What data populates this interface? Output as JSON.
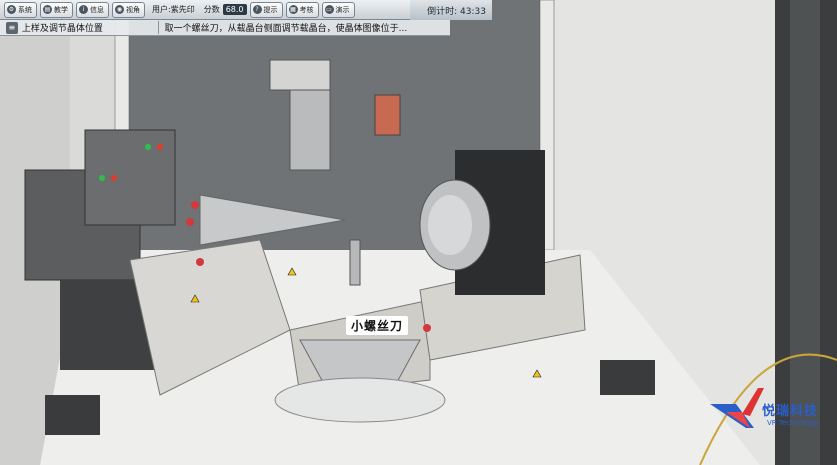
{
  "toolbar": {
    "buttons": [
      {
        "label": "系统",
        "icon": "gear-icon"
      },
      {
        "label": "教学",
        "icon": "book-icon"
      },
      {
        "label": "信息",
        "icon": "info-icon"
      },
      {
        "label": "视角",
        "icon": "camera-icon"
      }
    ],
    "user_label": "用户:紫先印",
    "score_label": "分数",
    "score_value": "68.0",
    "hint_label": "提示",
    "exam_label": "考核",
    "demo_label": "演示",
    "countdown": "倒计时: 43:33"
  },
  "step": {
    "title": "上样及调节晶体位置",
    "instruction": "取一个螺丝刀，从载晶台侧面调节载晶台，使晶体图像位于..."
  },
  "scene": {
    "tool_label": "小螺丝刀"
  },
  "brand": {
    "name": "悦瑞科技",
    "sub": "VR Technology",
    "accent": "#2a5ec9"
  }
}
